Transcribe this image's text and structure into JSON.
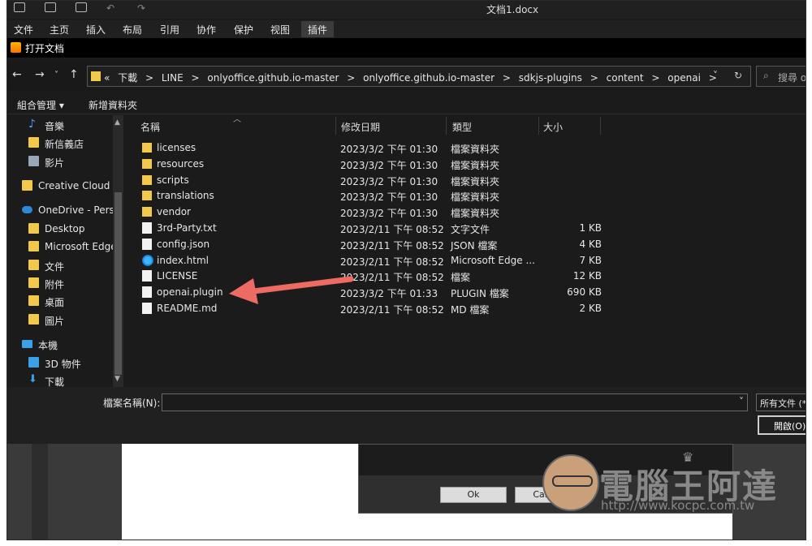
{
  "window": {
    "doc_title": "文档1.docx"
  },
  "menu": [
    "文件",
    "主页",
    "插入",
    "布局",
    "引用",
    "协作",
    "保护",
    "视图",
    "插件"
  ],
  "dialog": {
    "title": "打开文档"
  },
  "address": {
    "crumbs": [
      "«",
      "下載",
      ">",
      "LINE",
      ">",
      "onlyoffice.github.io-master",
      ">",
      "onlyoffice.github.io-master",
      ">",
      "sdkjs-plugins",
      ">",
      "content",
      ">",
      "openai",
      ">"
    ],
    "search_placeholder": "搜尋 o"
  },
  "toolbar": {
    "organize": "組合管理 ▾",
    "new_folder": "新增資料夾"
  },
  "sidebar": [
    {
      "label": "音樂",
      "icon": "music-icon",
      "color": "#4aa3ff"
    },
    {
      "label": "新信義店",
      "icon": "folder-icon",
      "color": "#f2c94c"
    },
    {
      "label": "影片",
      "icon": "video-icon",
      "color": "#9aa7b8"
    },
    {
      "label": "Creative Cloud Fi",
      "icon": "creative-cloud-icon",
      "color": "#f2c94c"
    },
    {
      "label": "OneDrive - Perso",
      "icon": "onedrive-icon",
      "color": "#2b88d8"
    },
    {
      "label": "Desktop",
      "icon": "folder-icon",
      "color": "#f2c94c"
    },
    {
      "label": "Microsoft Edge",
      "icon": "folder-icon",
      "color": "#f2c94c"
    },
    {
      "label": "文件",
      "icon": "folder-icon",
      "color": "#f2c94c"
    },
    {
      "label": "附件",
      "icon": "folder-icon",
      "color": "#f2c94c"
    },
    {
      "label": "桌面",
      "icon": "folder-icon",
      "color": "#f2c94c"
    },
    {
      "label": "圖片",
      "icon": "folder-icon",
      "color": "#f2c94c"
    },
    {
      "label": "本機",
      "icon": "computer-icon",
      "color": "#3aa0e8"
    },
    {
      "label": "3D 物件",
      "icon": "cube-icon",
      "color": "#3aa0e8"
    },
    {
      "label": "下載",
      "icon": "download-icon",
      "color": "#3aa0e8"
    }
  ],
  "columns": {
    "name": "名稱",
    "date": "修改日期",
    "type": "類型",
    "size": "大小"
  },
  "files": [
    {
      "name": "licenses",
      "date": "2023/3/2 下午 01:30",
      "type": "檔案資料夾",
      "size": "",
      "icon": "folder"
    },
    {
      "name": "resources",
      "date": "2023/3/2 下午 01:30",
      "type": "檔案資料夾",
      "size": "",
      "icon": "folder"
    },
    {
      "name": "scripts",
      "date": "2023/3/2 下午 01:30",
      "type": "檔案資料夾",
      "size": "",
      "icon": "folder"
    },
    {
      "name": "translations",
      "date": "2023/3/2 下午 01:30",
      "type": "檔案資料夾",
      "size": "",
      "icon": "folder"
    },
    {
      "name": "vendor",
      "date": "2023/3/2 下午 01:30",
      "type": "檔案資料夾",
      "size": "",
      "icon": "folder"
    },
    {
      "name": "3rd-Party.txt",
      "date": "2023/2/11 下午 08:52",
      "type": "文字文件",
      "size": "1 KB",
      "icon": "file"
    },
    {
      "name": "config.json",
      "date": "2023/2/11 下午 08:52",
      "type": "JSON 檔案",
      "size": "4 KB",
      "icon": "file"
    },
    {
      "name": "index.html",
      "date": "2023/2/11 下午 08:52",
      "type": "Microsoft Edge ...",
      "size": "7 KB",
      "icon": "web"
    },
    {
      "name": "LICENSE",
      "date": "2023/2/11 下午 08:52",
      "type": "檔案",
      "size": "12 KB",
      "icon": "file"
    },
    {
      "name": "openai.plugin",
      "date": "2023/3/2 下午 01:33",
      "type": "PLUGIN 檔案",
      "size": "690 KB",
      "icon": "file"
    },
    {
      "name": "README.md",
      "date": "2023/2/11 下午 08:52",
      "type": "MD 檔案",
      "size": "2 KB",
      "icon": "file"
    }
  ],
  "bottom": {
    "filename_label": "檔案名稱(N):",
    "filetype": "所有文件 (*",
    "open": "開啟(O)"
  },
  "behind": {
    "ok": "Ok",
    "cancel": "Cancel"
  },
  "watermark": {
    "brand": "電腦王阿達",
    "url": "http://www.kocpc.com.tw"
  },
  "colors": {
    "arrow": "#ee6b64",
    "folder": "#f2c94c"
  }
}
